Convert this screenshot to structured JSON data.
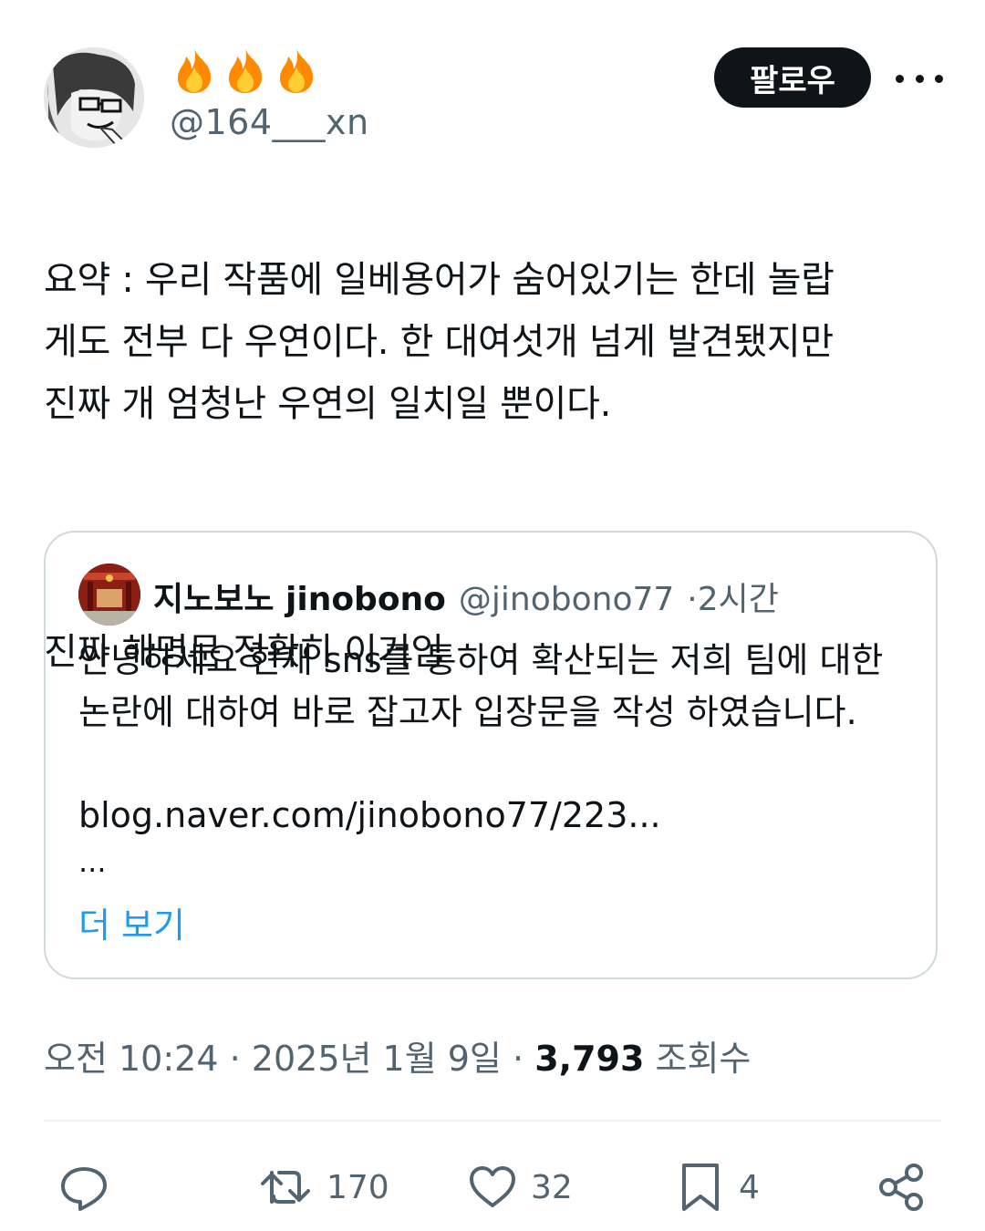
{
  "author": {
    "display_name_emojis": [
      "fire",
      "fire",
      "fire"
    ],
    "handle": "@164___xn",
    "avatar": "avatar-manga-glasses"
  },
  "header": {
    "follow_label": "팔로우",
    "more_icon": "more-horizontal-icon"
  },
  "tweet": {
    "paragraph_1": "요약 : 우리 작품에 일베용어가 숨어있기는 한데 놀랍\n게도 전부 다 우연이다. 한 대여섯개 넘게 발견됐지만\n진짜 개 엄청난 우연의 일치일 뿐이다.",
    "paragraph_2": "진짜 해명문 정확히 이거임"
  },
  "quote": {
    "name": "지노보노 jinobono",
    "handle": "@jinobono77",
    "separator": "·",
    "time": "2시간",
    "body": "안녕하세요 현재 sns를 통하여 확산되는 저희 팀에 대한\n논란에 대하여 바로 잡고자 입장문을 작성 하였습니다.",
    "link": "blog.naver.com/jinobono77/223...",
    "ellipsis": "...",
    "show_more": "더 보기"
  },
  "meta": {
    "time": "오전 10:24",
    "separator": "·",
    "date": "2025년 1월 9일",
    "views": "3,793",
    "views_label": "조회수"
  },
  "actions": {
    "reply_icon": "reply-icon",
    "retweet_count": "170",
    "like_count": "32",
    "bookmark_count": "4",
    "share_icon": "share-icon"
  },
  "colors": {
    "text": "#0f1419",
    "muted": "#536471",
    "link": "#1d9bf0",
    "border": "#cfd9de",
    "button_bg": "#0f1419"
  }
}
